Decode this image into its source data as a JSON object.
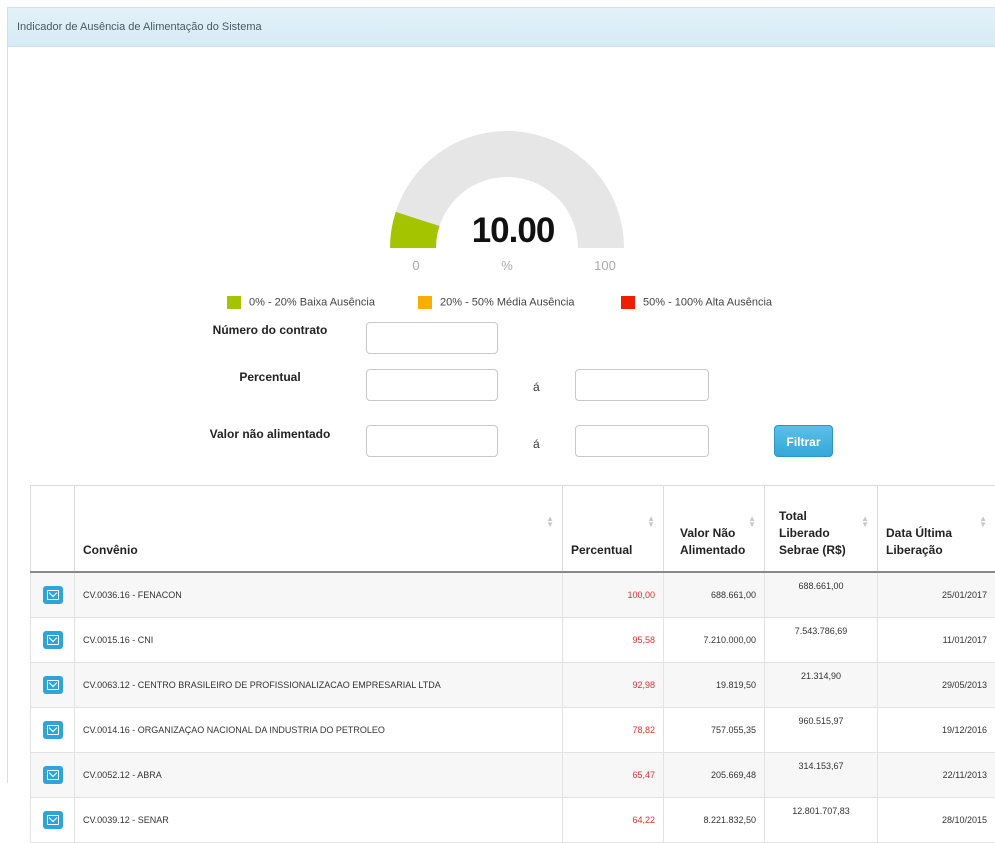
{
  "panel": {
    "title": "Indicador de Ausência de Alimentação do Sistema"
  },
  "gauge": {
    "value": 10,
    "value_text": "10.00",
    "min_label": "0",
    "unit_label": "%",
    "max_label": "100",
    "fill_color": "#a5c400",
    "track_color": "#e6e6e6"
  },
  "legend": [
    {
      "label": "0% - 20% Baixa Ausência",
      "color": "#a5c400"
    },
    {
      "label": "20% - 50% Média Ausência",
      "color": "#f7ae00"
    },
    {
      "label": "50% - 100% Alta Ausência",
      "color": "#ee1f00"
    }
  ],
  "form": {
    "contract_label": "Número do contrato",
    "percent_label": "Percentual",
    "value_label": "Valor não alimentado",
    "range_separator": "á",
    "contract_value": "",
    "percent_from": "",
    "percent_to": "",
    "value_from": "",
    "value_to": "",
    "filter_button": "Filtrar"
  },
  "table": {
    "headers": {
      "convenio": "Convênio",
      "percentual": "Percentual",
      "valor": "Valor Não Alimentado",
      "total": "Total Liberado Sebrae (R$)",
      "data": "Data Última Liberação"
    },
    "rows": [
      {
        "convenio": "CV.0036.16 - FENACON",
        "percentual": "100,00",
        "valor": "688.661,00",
        "total": "688.661,00",
        "data": "25/01/2017"
      },
      {
        "convenio": "CV.0015.16 - CNI",
        "percentual": "95,58",
        "valor": "7.210.000,00",
        "total": "7.543.786,69",
        "data": "11/01/2017"
      },
      {
        "convenio": "CV.0063.12 - CENTRO BRASILEIRO DE PROFISSIONALIZACAO EMPRESARIAL LTDA",
        "percentual": "92,98",
        "valor": "19.819,50",
        "total": "21.314,90",
        "data": "29/05/2013"
      },
      {
        "convenio": "CV.0014.16 - ORGANIZAÇAO NACIONAL DA INDUSTRIA DO PETROLEO",
        "percentual": "78,82",
        "valor": "757.055,35",
        "total": "960.515,97",
        "data": "19/12/2016"
      },
      {
        "convenio": "CV.0052.12 - ABRA",
        "percentual": "65,47",
        "valor": "205.669,48",
        "total": "314.153,67",
        "data": "22/11/2013"
      },
      {
        "convenio": "CV.0039.12 - SENAR",
        "percentual": "64,22",
        "valor": "8.221.832,50",
        "total": "12.801.707,83",
        "data": "28/10/2015"
      }
    ]
  }
}
